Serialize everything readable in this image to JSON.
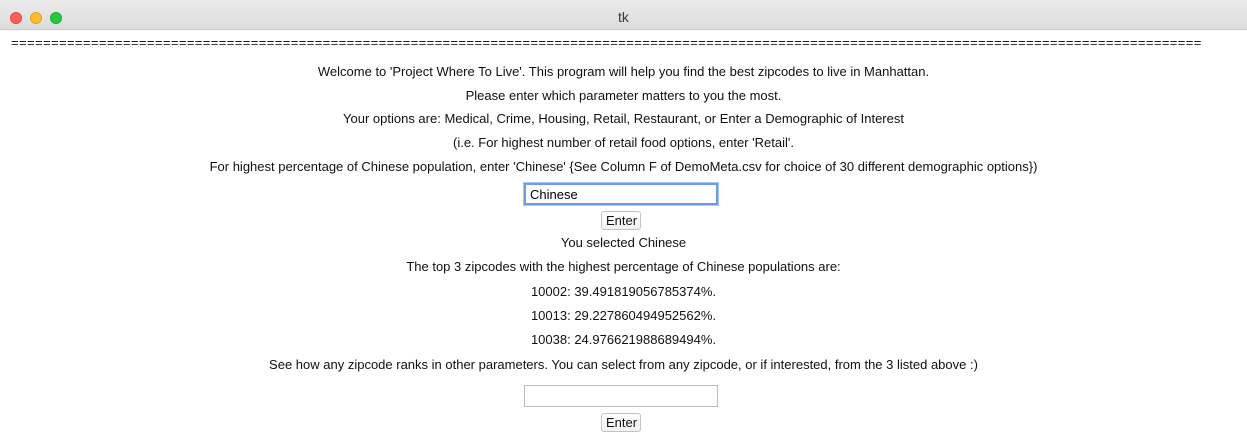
{
  "window": {
    "title": "tk"
  },
  "separator": "=====================================================================================================================================================",
  "intro": {
    "welcome": "Welcome to 'Project Where To Live'. This program will help you find the best zipcodes to live in Manhattan.",
    "prompt": "Please enter which parameter matters to you the most.",
    "options": "Your options are: Medical, Crime, Housing, Retail, Restaurant, or Enter a Demographic of Interest",
    "example_retail": "(i.e. For highest number of retail food options, enter 'Retail'.",
    "example_demo": "For highest percentage of Chinese population, enter 'Chinese' {See Column F of DemoMeta.csv for choice of 30 different demographic options})"
  },
  "parameter_input": {
    "value": "Chinese",
    "placeholder": ""
  },
  "enter_button_1": {
    "label": "Enter"
  },
  "results": {
    "selected": "You selected Chinese",
    "heading": "The top 3 zipcodes with the highest percentage of Chinese populations are:",
    "items": [
      "10002: 39.491819056785374%.",
      "10013: 29.227860494952562%.",
      "10038: 24.976621988689494%."
    ]
  },
  "rank_prompt": "See how any zipcode ranks in other parameters. You can select from any zipcode, or if interested, from the 3 listed above :)",
  "zipcode_input": {
    "value": "",
    "placeholder": ""
  },
  "enter_button_2": {
    "label": "Enter"
  },
  "colors": {
    "close": "#fc5f57",
    "minimize": "#fdbc2e",
    "zoom": "#28c840",
    "focus_ring": "#6a9be3"
  }
}
